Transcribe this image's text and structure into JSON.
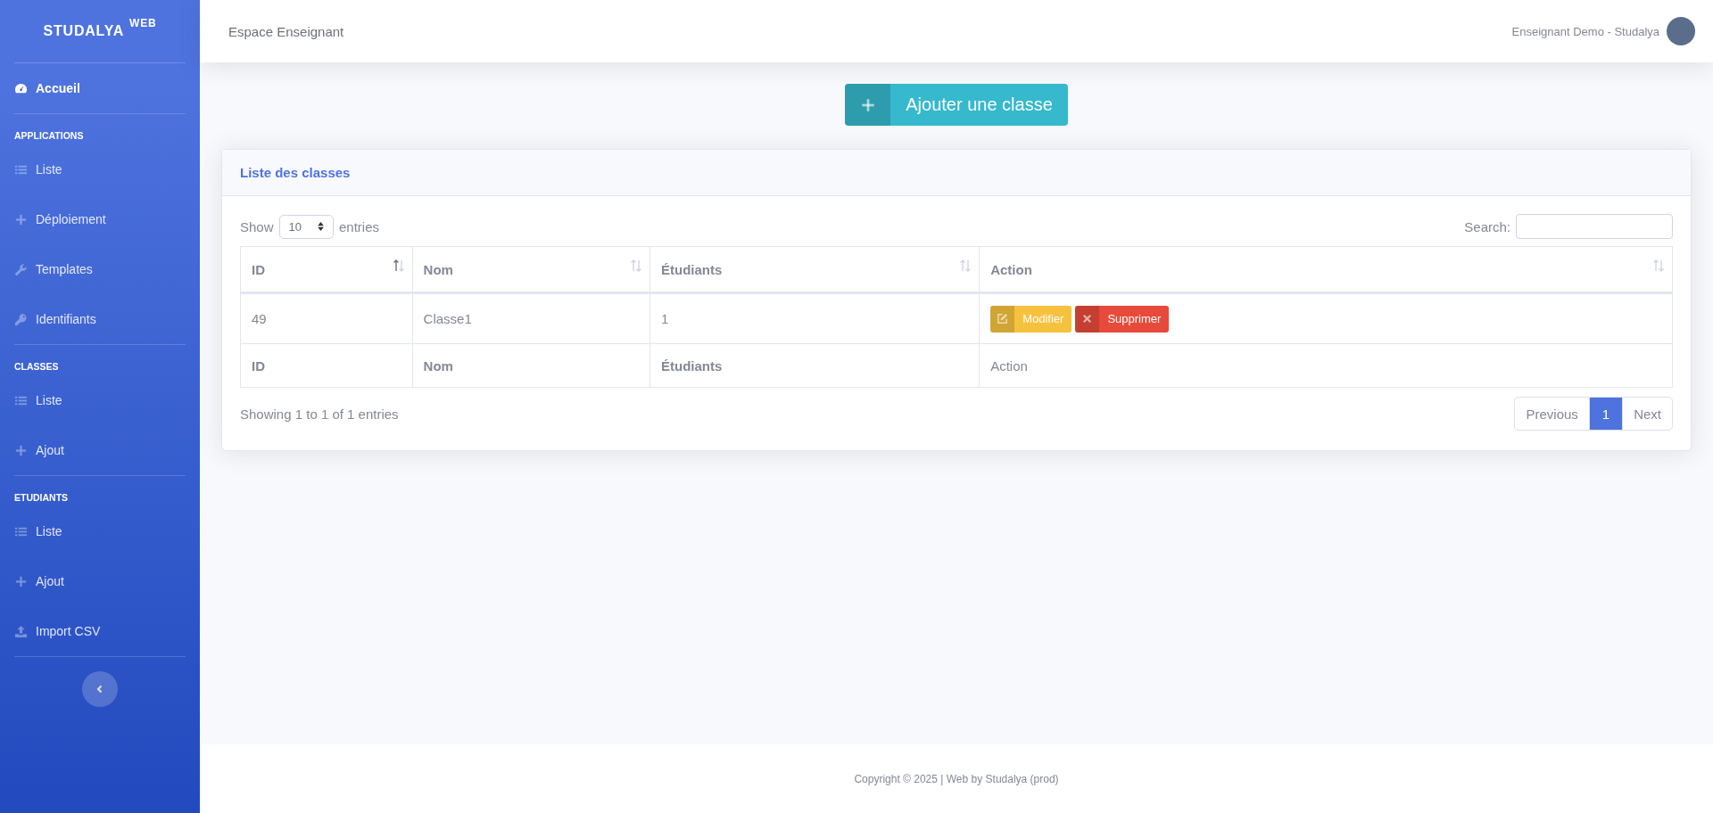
{
  "sidebar": {
    "brand": {
      "name": "STUDALYA",
      "tag": "WEB"
    },
    "sections": [
      {
        "items": [
          {
            "label": "Accueil",
            "kind": "gauge",
            "selected": true
          }
        ]
      },
      {
        "heading": "APPLICATIONS",
        "items": [
          {
            "label": "Liste",
            "kind": "list",
            "selected": false
          },
          {
            "label": "Déploiement",
            "kind": "plus",
            "selected": false
          },
          {
            "label": "Templates",
            "kind": "wrench",
            "selected": false
          },
          {
            "label": "Identifiants",
            "kind": "key",
            "selected": false
          }
        ]
      },
      {
        "heading": "CLASSES",
        "items": [
          {
            "label": "Liste",
            "kind": "list",
            "selected": false
          },
          {
            "label": "Ajout",
            "kind": "plus",
            "selected": false
          }
        ]
      },
      {
        "heading": "ETUDIANTS",
        "items": [
          {
            "label": "Liste",
            "kind": "list",
            "selected": false
          },
          {
            "label": "Ajout",
            "kind": "plus",
            "selected": false
          },
          {
            "label": "Import CSV",
            "kind": "upload",
            "selected": false
          }
        ]
      }
    ]
  },
  "topbar": {
    "title": "Espace Enseignant",
    "user": "Enseignant Demo - Studalya"
  },
  "add_button": {
    "label": "Ajouter une classe"
  },
  "card": {
    "title": "Liste des classes",
    "length": {
      "before": "Show",
      "value": "10",
      "after": "entries"
    },
    "search": {
      "label": "Search:"
    },
    "columns": [
      {
        "label": "ID",
        "sorted": true
      },
      {
        "label": "Nom",
        "sorted": false
      },
      {
        "label": "Étudiants",
        "sorted": false
      },
      {
        "label": "Action",
        "sorted": false
      }
    ],
    "rows": [
      {
        "cells": [
          "49",
          "Classe1",
          "1"
        ],
        "actions": [
          {
            "kind": "edit",
            "label": "Modifier"
          },
          {
            "kind": "delete",
            "label": "Supprimer"
          }
        ]
      }
    ],
    "footer": [
      {
        "label": "ID",
        "bold": true
      },
      {
        "label": "Nom",
        "bold": true
      },
      {
        "label": "Étudiants",
        "bold": true
      },
      {
        "label": "Action",
        "bold": false
      }
    ],
    "info": "Showing 1 to 1 of 1 entries",
    "pagination": [
      {
        "label": "Previous",
        "selected": false
      },
      {
        "label": "1",
        "selected": true
      },
      {
        "label": "Next",
        "selected": false
      }
    ]
  },
  "footer": {
    "text": "Copyright © 2025 | Web by Studalya (prod)"
  }
}
